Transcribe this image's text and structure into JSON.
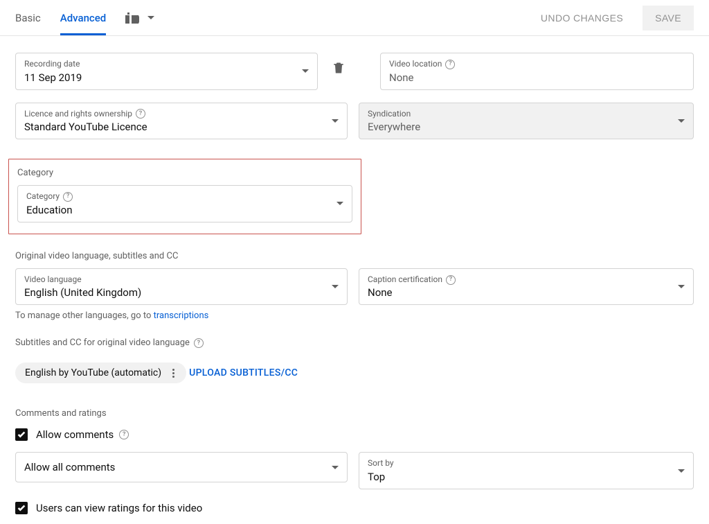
{
  "tabs": {
    "basic": "Basic",
    "advanced": "Advanced"
  },
  "actions": {
    "undo": "UNDO CHANGES",
    "save": "SAVE"
  },
  "recording_date": {
    "label": "Recording date",
    "value": "11 Sep 2019"
  },
  "video_location": {
    "label": "Video location",
    "value": "None"
  },
  "licence": {
    "label": "Licence and rights ownership",
    "value": "Standard YouTube Licence"
  },
  "syndication": {
    "label": "Syndication",
    "value": "Everywhere"
  },
  "category_section": {
    "title": "Category",
    "label": "Category",
    "value": "Education"
  },
  "lang_section_title": "Original video language, subtitles and CC",
  "video_language": {
    "label": "Video language",
    "value": "English (United Kingdom)"
  },
  "caption_cert": {
    "label": "Caption certification",
    "value": "None"
  },
  "lang_hint_pre": "To manage other languages, go to ",
  "lang_hint_link": "transcriptions",
  "cc_label": "Subtitles and CC for original video language",
  "cc_chip": "English by YouTube (automatic)",
  "upload_cc": "UPLOAD SUBTITLES/CC",
  "comments_title": "Comments and ratings",
  "allow_comments": "Allow comments",
  "comment_mode": {
    "value": "Allow all comments"
  },
  "sort_by": {
    "label": "Sort by",
    "value": "Top"
  },
  "ratings_label": "Users can view ratings for this video"
}
